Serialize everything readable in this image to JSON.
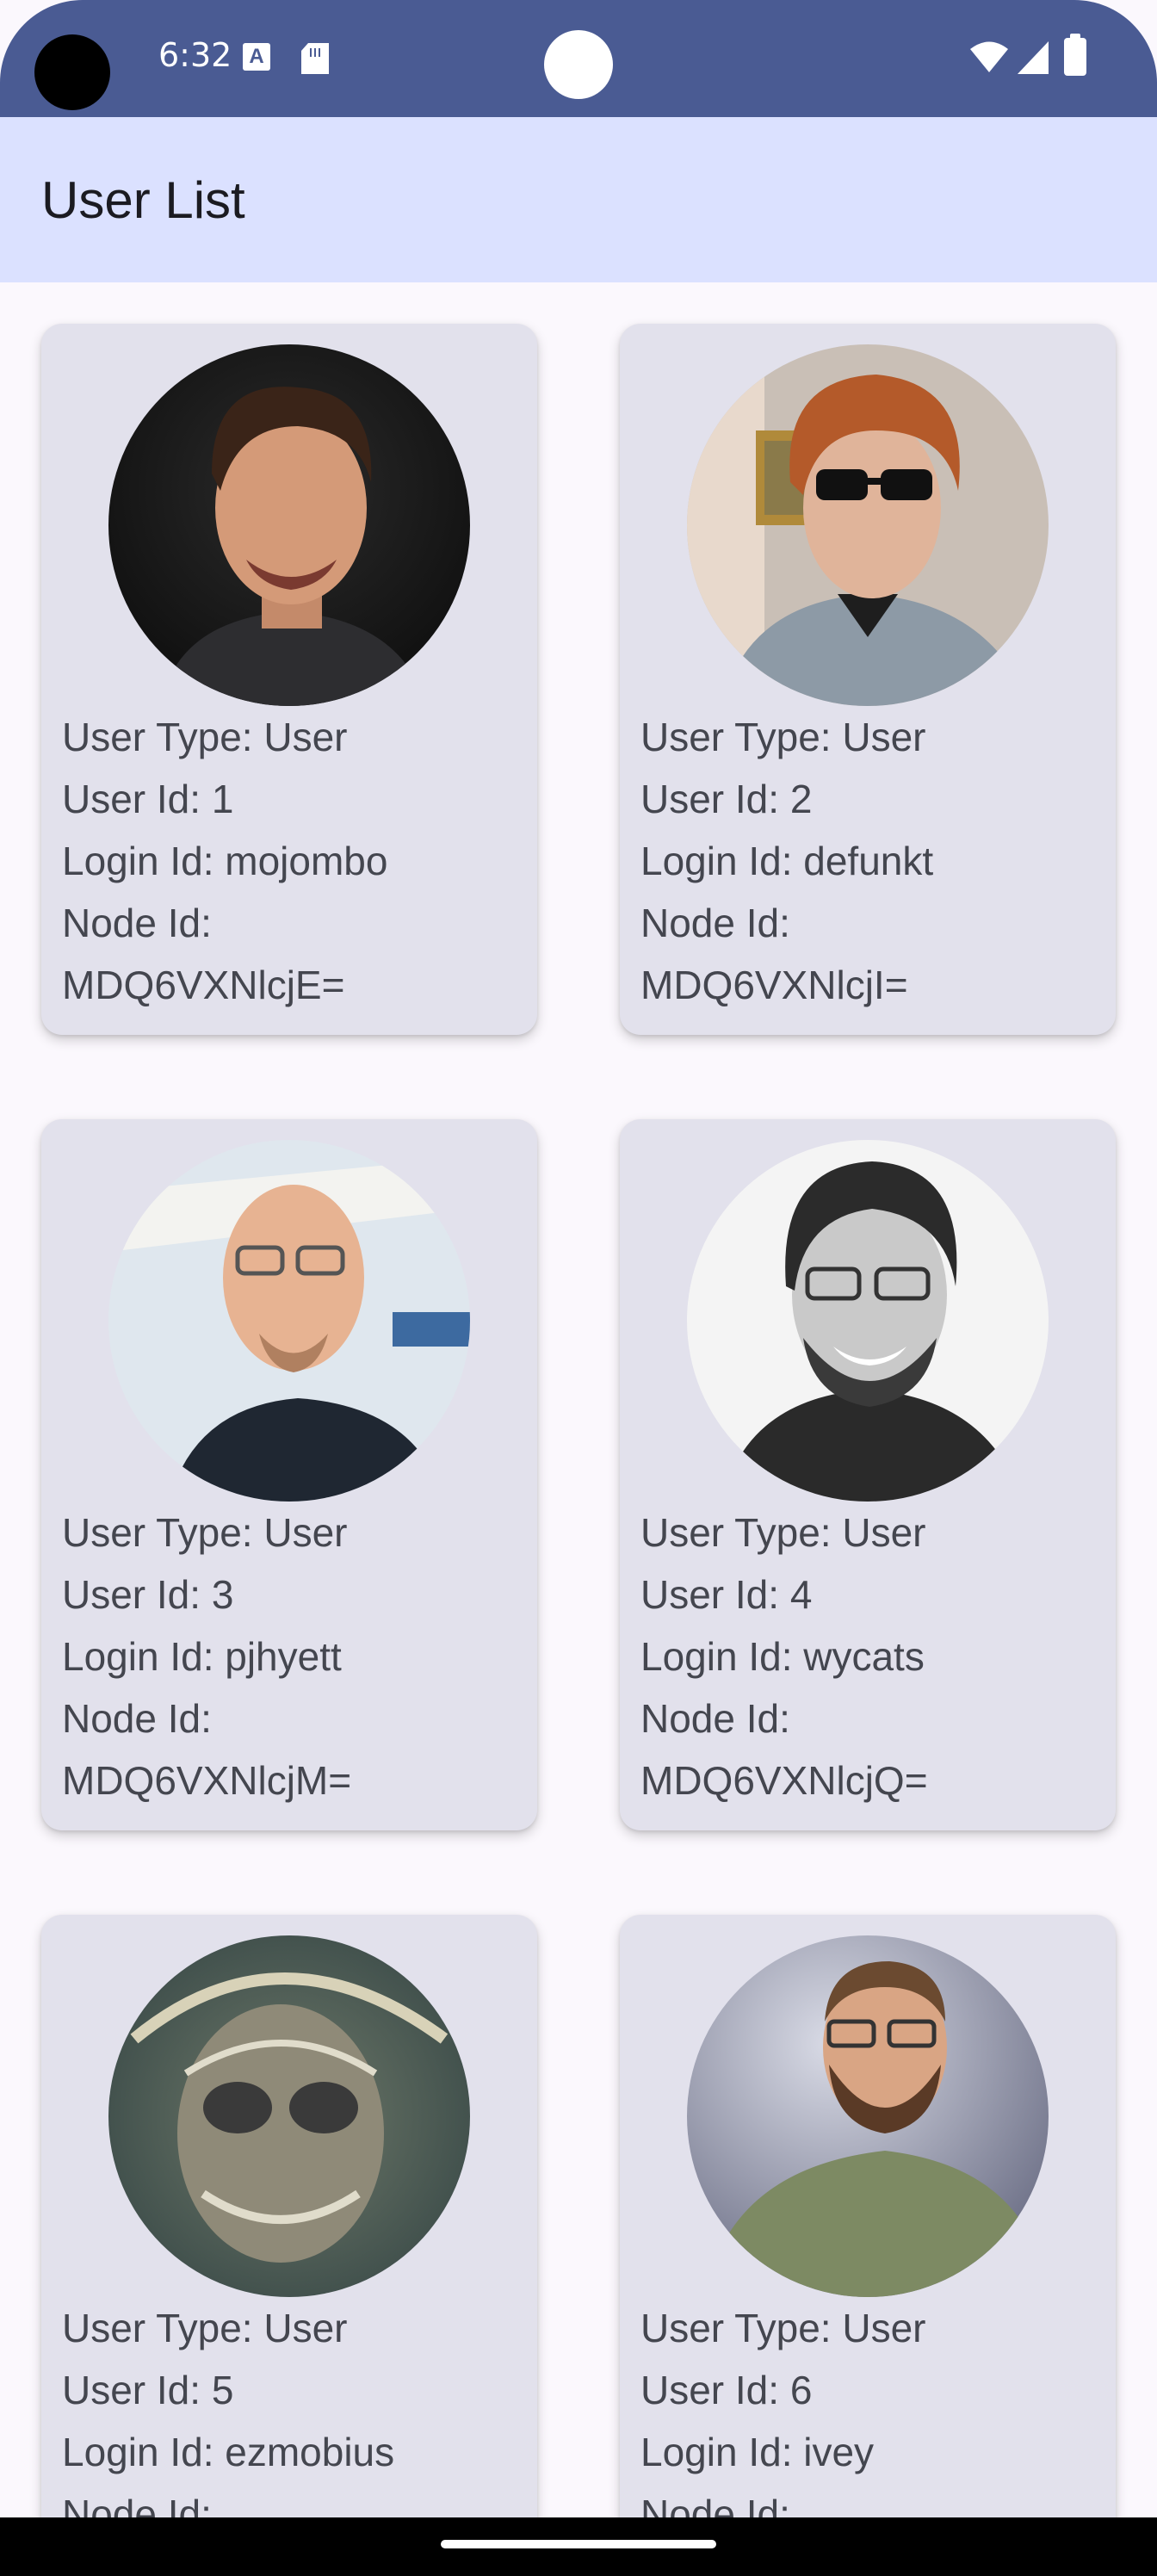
{
  "status_bar": {
    "time": "6:32",
    "icons": [
      "text-a-notification-icon",
      "sd-card-icon",
      "wifi-icon",
      "signal-icon",
      "battery-icon"
    ]
  },
  "app_bar": {
    "title": "User List"
  },
  "colors": {
    "status_bar": "#4a5b93",
    "app_bar": "#dbe1ff",
    "card": "#e2e1ec",
    "text": "#44464f",
    "background": "#fbf8fd"
  },
  "users": [
    {
      "user_type": "User Type: User",
      "user_id": "User Id: 1",
      "login_id": "Login Id: mojombo",
      "node_label": "Node Id:",
      "node_id": "MDQ6VXNlcjE="
    },
    {
      "user_type": "User Type: User",
      "user_id": "User Id: 2",
      "login_id": "Login Id: defunkt",
      "node_label": "Node Id:",
      "node_id": "MDQ6VXNlcjI="
    },
    {
      "user_type": "User Type: User",
      "user_id": "User Id: 3",
      "login_id": "Login Id: pjhyett",
      "node_label": "Node Id:",
      "node_id": "MDQ6VXNlcjM="
    },
    {
      "user_type": "User Type: User",
      "user_id": "User Id: 4",
      "login_id": "Login Id: wycats",
      "node_label": "Node Id:",
      "node_id": "MDQ6VXNlcjQ="
    },
    {
      "user_type": "User Type: User",
      "user_id": "User Id: 5",
      "login_id": "Login Id: ezmobius",
      "node_label": "Node Id:",
      "node_id": ""
    },
    {
      "user_type": "User Type: User",
      "user_id": "User Id: 6",
      "login_id": "Login Id: ivey",
      "node_label": "Node Id:",
      "node_id": ""
    }
  ]
}
